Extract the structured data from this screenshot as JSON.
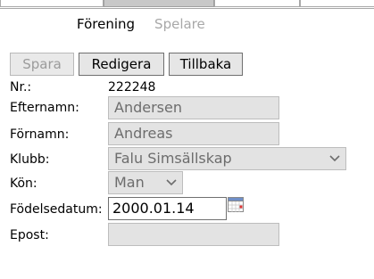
{
  "subnav": {
    "active": "Förening",
    "inactive": "Spelare"
  },
  "toolbar": {
    "save_label": "Spara",
    "edit_label": "Redigera",
    "back_label": "Tillbaka"
  },
  "form": {
    "nr_label": "Nr.:",
    "nr_value": "222248",
    "lastname_label": "Efternamn:",
    "lastname_value": "Andersen",
    "firstname_label": "Förnamn:",
    "firstname_value": "Andreas",
    "club_label": "Klubb:",
    "club_value": "Falu Simsällskap",
    "gender_label": "Kön:",
    "gender_value": "Man",
    "birthdate_label": "Födelsedatum:",
    "birthdate_value": "2000.01.14",
    "email_label": "Epost:",
    "email_value": ""
  },
  "icons": {
    "select_arrow": "chevron-down-icon",
    "calendar": "calendar-icon"
  },
  "colors": {
    "disabled_field": "#e3e3e3",
    "disabled_text": "#6d6d6d",
    "active_tab": "#c8c8c8"
  }
}
